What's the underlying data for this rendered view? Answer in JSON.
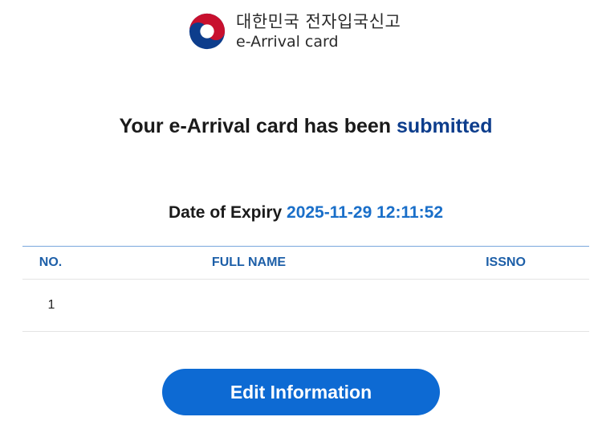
{
  "header": {
    "title_ko": "대한민국 전자입국신고",
    "title_en": "e-Arrival card"
  },
  "headline": {
    "text": "Your e-Arrival card has been ",
    "status": "submitted"
  },
  "expiry": {
    "label": "Date of Expiry ",
    "value": "2025-11-29 12:11:52"
  },
  "table": {
    "columns": [
      "NO.",
      "FULL NAME",
      "ISSNO"
    ],
    "rows": [
      {
        "no": "1",
        "full_name": "",
        "issno": ""
      }
    ]
  },
  "actions": {
    "edit_label": "Edit Information"
  },
  "colors": {
    "emblem_red": "#c8102e",
    "emblem_blue": "#0d3d8c",
    "accent_blue": "#1a6fc9",
    "button_blue": "#0d6ad3"
  },
  "icons": {
    "logo": "korea-taegeuk-emblem-icon"
  }
}
